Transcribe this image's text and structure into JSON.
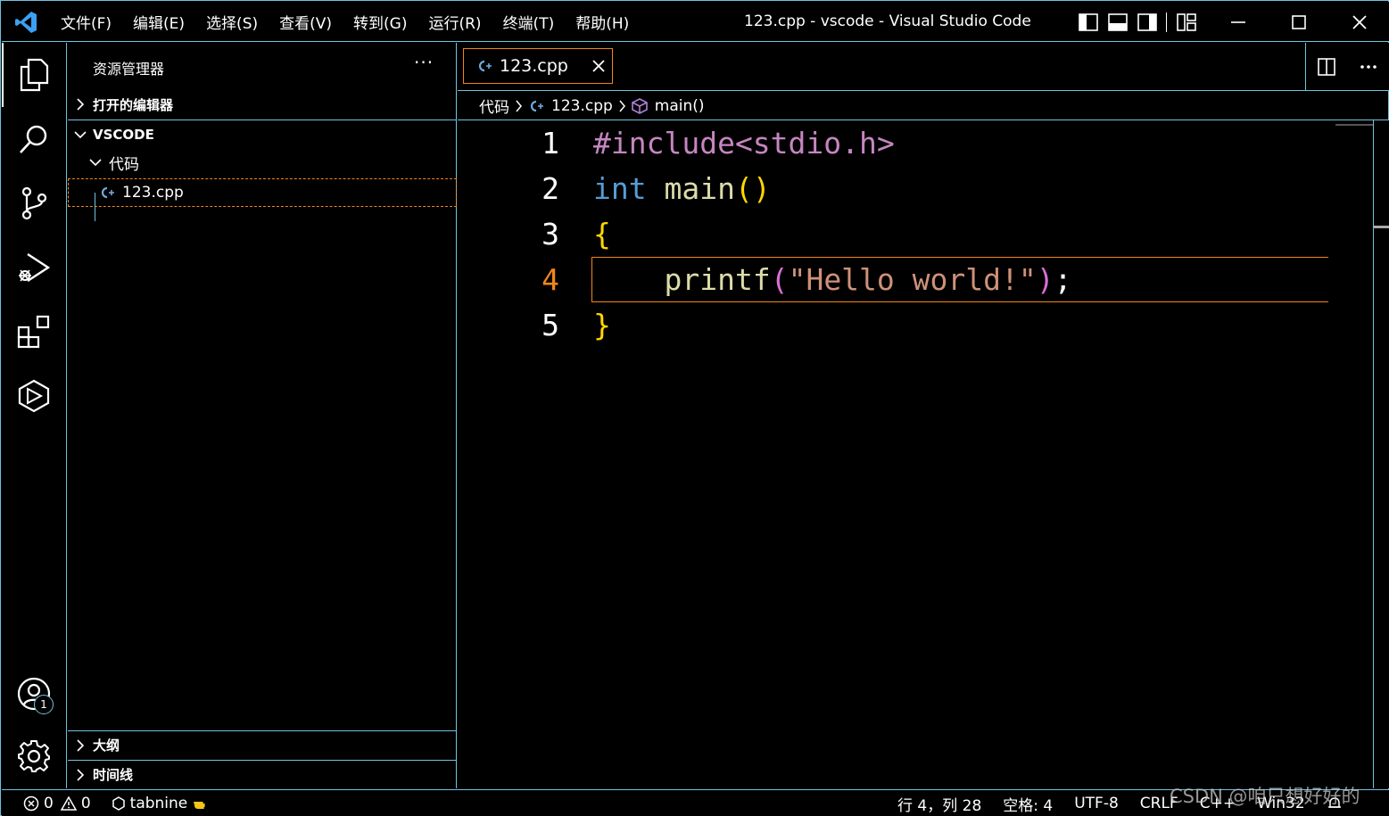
{
  "app": {
    "window_title": "123.cpp - vscode - Visual Studio Code",
    "logo_icon": "vscode-logo-icon"
  },
  "menu": [
    "文件(F)",
    "编辑(E)",
    "选择(S)",
    "查看(V)",
    "转到(G)",
    "运行(R)",
    "终端(T)",
    "帮助(H)"
  ],
  "sidebar": {
    "title": "资源管理器",
    "more": "···",
    "open_editors": "打开的编辑器",
    "workspace": "VSCODE",
    "folder": "代码",
    "file": "123.cpp",
    "outline": "大纲",
    "timeline": "时间线"
  },
  "activity_bar": {
    "items": [
      "explorer-icon",
      "search-icon",
      "source-control-icon",
      "run-debug-icon",
      "extensions-icon",
      "tabnine-hub-icon"
    ],
    "accounts_badge": "1"
  },
  "editor": {
    "tab_label": "123.cpp",
    "breadcrumb": [
      "代码",
      "123.cpp",
      "main()"
    ],
    "current_line": 4,
    "lines": [
      {
        "n": "1",
        "tokens": [
          {
            "t": "#include<stdio.h>",
            "c": "pp"
          }
        ]
      },
      {
        "n": "2",
        "tokens": [
          {
            "t": "int",
            "c": "kw"
          },
          {
            "t": " ",
            "c": "pl"
          },
          {
            "t": "main",
            "c": "fn"
          },
          {
            "t": "()",
            "c": "br"
          }
        ]
      },
      {
        "n": "3",
        "tokens": [
          {
            "t": "{",
            "c": "br"
          }
        ]
      },
      {
        "n": "4",
        "tokens": [
          {
            "t": "    ",
            "c": "pl"
          },
          {
            "t": "printf",
            "c": "fn"
          },
          {
            "t": "(",
            "c": "br2"
          },
          {
            "t": "\"Hello world!\"",
            "c": "str"
          },
          {
            "t": ")",
            "c": "br2"
          },
          {
            "t": ";",
            "c": "pl"
          }
        ]
      },
      {
        "n": "5",
        "tokens": [
          {
            "t": "}",
            "c": "br"
          }
        ]
      }
    ]
  },
  "status": {
    "errors": "0",
    "warnings": "0",
    "tabnine": "tabnine",
    "position": "行 4，列 28",
    "spaces": "空格: 4",
    "encoding": "UTF-8",
    "eol": "CRLF",
    "language": "C++",
    "config": "Win32"
  },
  "watermark": "CSDN @咱只想好好的",
  "colors": {
    "contrast_border": "#6fc3df",
    "active_border": "#f38518",
    "keyword": "#569cd6",
    "function": "#dcdcaa",
    "string": "#ce9178",
    "preprocessor": "#c586c0",
    "bracket1": "#ffd700",
    "bracket2": "#da70d6"
  }
}
